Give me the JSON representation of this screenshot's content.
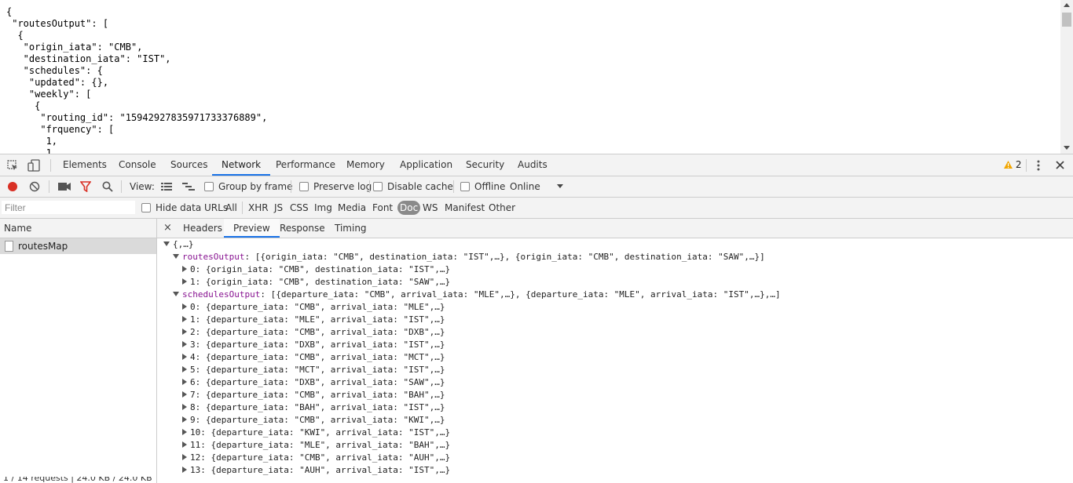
{
  "page_json_text": "{\n \"routesOutput\": [\n  {\n   \"origin_iata\": \"CMB\",\n   \"destination_iata\": \"IST\",\n   \"schedules\": {\n    \"updated\": {},\n    \"weekly\": [\n     {\n      \"routing_id\": \"15942927835971733376889\",\n      \"frquency\": [\n       1,\n       1",
  "devtools": {
    "tabs": [
      "Elements",
      "Console",
      "Sources",
      "Network",
      "Performance",
      "Memory",
      "Application",
      "Security",
      "Audits"
    ],
    "active_tab": "Network",
    "warning_count": "2",
    "toolbar": {
      "view_label": "View:",
      "group_by_frame": "Group by frame",
      "preserve_log": "Preserve log",
      "disable_cache": "Disable cache",
      "offline": "Offline",
      "throttling": "Online"
    },
    "filter": {
      "placeholder": "Filter",
      "hide_data_urls": "Hide data URLs",
      "types": [
        "All",
        "XHR",
        "JS",
        "CSS",
        "Img",
        "Media",
        "Font",
        "Doc",
        "WS",
        "Manifest",
        "Other"
      ],
      "selected_type": "Doc"
    },
    "requests": {
      "column_name": "Name",
      "items": [
        "routesMap"
      ],
      "status_text": "1 / 14 requests | 24.0 KB / 24.0 KB"
    },
    "detail": {
      "tabs": [
        "Headers",
        "Preview",
        "Response",
        "Timing"
      ],
      "active_tab": "Preview",
      "close_symbol": "×"
    },
    "preview": {
      "root": "{,…}",
      "routes_key": "routesOutput",
      "routes_summary": "[{origin_iata: \"CMB\", destination_iata: \"IST\",…}, {origin_iata: \"CMB\", destination_iata: \"SAW\",…}]",
      "routes": [
        "0: {origin_iata: \"CMB\", destination_iata: \"IST\",…}",
        "1: {origin_iata: \"CMB\", destination_iata: \"SAW\",…}"
      ],
      "schedules_key": "schedulesOutput",
      "schedules_summary": "[{departure_iata: \"CMB\", arrival_iata: \"MLE\",…}, {departure_iata: \"MLE\", arrival_iata: \"IST\",…},…]",
      "schedules": [
        "0: {departure_iata: \"CMB\", arrival_iata: \"MLE\",…}",
        "1: {departure_iata: \"MLE\", arrival_iata: \"IST\",…}",
        "2: {departure_iata: \"CMB\", arrival_iata: \"DXB\",…}",
        "3: {departure_iata: \"DXB\", arrival_iata: \"IST\",…}",
        "4: {departure_iata: \"CMB\", arrival_iata: \"MCT\",…}",
        "5: {departure_iata: \"MCT\", arrival_iata: \"IST\",…}",
        "6: {departure_iata: \"DXB\", arrival_iata: \"SAW\",…}",
        "7: {departure_iata: \"CMB\", arrival_iata: \"BAH\",…}",
        "8: {departure_iata: \"BAH\", arrival_iata: \"IST\",…}",
        "9: {departure_iata: \"CMB\", arrival_iata: \"KWI\",…}",
        "10: {departure_iata: \"KWI\", arrival_iata: \"IST\",…}",
        "11: {departure_iata: \"MLE\", arrival_iata: \"BAH\",…}",
        "12: {departure_iata: \"CMB\", arrival_iata: \"AUH\",…}",
        "13: {departure_iata: \"AUH\", arrival_iata: \"IST\",…}"
      ]
    }
  },
  "colors": {
    "accent": "#1a73e8",
    "record": "#d93025",
    "filter_icon": "#d93025",
    "warning": "#f2a600"
  }
}
